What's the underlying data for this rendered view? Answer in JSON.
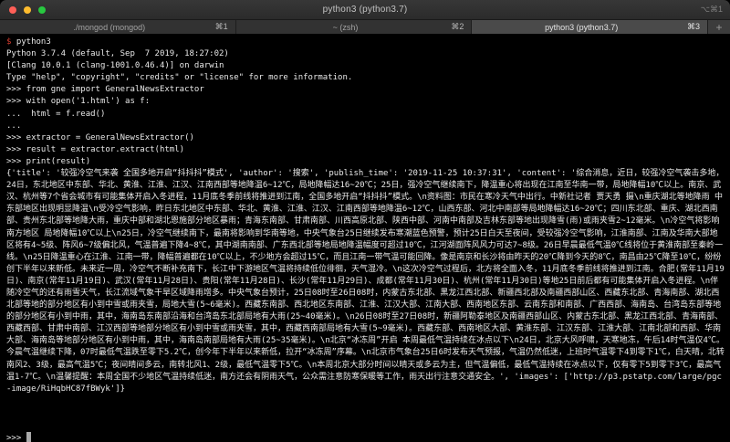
{
  "window": {
    "title": "python3 (python3.7)",
    "titlebar_right_hint": "⌥⌘1",
    "tabs": [
      {
        "label": "./mongod (mongod)",
        "shortcut": "⌘1"
      },
      {
        "label": "~ (zsh)",
        "shortcut": "⌘2"
      },
      {
        "label": "python3 (python3.7)",
        "shortcut": "⌘3"
      }
    ],
    "new_tab_label": "+"
  },
  "colors": {
    "prompt_red": "#d23b2e",
    "terminal_bg": "#000000",
    "terminal_fg": "#e9e9e9",
    "active_tab_bg": "#4a4a4a",
    "traffic_red": "#ff5f57",
    "traffic_yellow": "#febc2e",
    "traffic_green": "#28c840"
  },
  "terminal": {
    "shell_line": {
      "prompt": "$",
      "command": " python3"
    },
    "lines": [
      "Python 3.7.4 (default, Sep  7 2019, 18:27:02)",
      "[Clang 10.0.1 (clang-1001.0.46.4)] on darwin",
      "Type \"help\", \"copyright\", \"credits\" or \"license\" for more information.",
      ">>> from gne import GeneralNewsExtractor",
      ">>> with open('1.html') as f:",
      "...  html = f.read()",
      "...",
      ">>> extractor = GeneralNewsExtractor()",
      ">>> result = extractor.extract(html)",
      ">>> print(result)"
    ],
    "output": "{'title': '较强冷空气来袭 全国多地开启“抖抖抖”模式', 'author': '搜索', 'publish_time': '2019-11-25 10:37:31', 'content': '综合消息，近日，较强冷空气袭击多地，24日，东北地区中东部、华北、黄淮、江淮、江汉、江南西部等地降温6~12℃，局地降幅达16~20℃；25日，强冷空气继续南下，降温重心将出现在江南至华南一带，局地降幅10℃以上。南京、武汉、杭州等7个省会城市有可能集体开启入冬进程，11月底冬季前线将推进到江南，全国多地开启“抖抖抖”模式。\\n资料图：市民在寒冷天气中出行。中新社记者 贾天勇 摄\\n重庆湖北等地降雨 中东部地区出现明显降温\\n受冷空气影响，昨日东北地区中东部、华北、黄淮、江淮、江汉、江南西部等地降温6~12℃，山西东部、河北中南部等局地降幅达16~20℃；四川东北部、重庆、湖北西南部、贵州东北部等地降大雨，重庆中部和湖北恩施部分地区暴雨；青海东南部、甘肃南部、川西高原北部、陕西中部、河南中南部及吉林东部等地出现降雪(雨)或雨夹雪2~12毫米。\\n冷空气将影响南方地区 局地降幅10℃以上\\n25日，冷空气继续南下，最南将影响到华南等地，中央气象台25日继续发布寒潮蓝色预警，预计25日白天至夜间，受较强冷空气影响，江淮南部、江南及华南大部地区将有4~5级、阵风6~7级偏北风，气温普遍下降4~8℃，其中湖南南部、广东西北部等地局地降温幅度可超过10℃，江河湖面阵风风力可达7~8级。26日早晨最低气温0℃线将位于黄淮南部至秦岭一线。\\n25日降温重心在江淮、江南一带，降幅普遍都在10℃以上，不少地方会超过15℃，而且江南一带气温可能回降。像是南京和长沙将由昨天的20℃降到今天的8℃，南昌由25℃降至10℃，纷纷创下半年以来新低。未来近一周，冷空气不断补充南下，长江中下游地区气温将持续低位徘徊，天气湿冷。\\n这次冷空气过程后，北方将全面入冬，11月底冬季前线将推进到江南。合肥(常年11月19日)、南京(常年11月19日)、武汉(常年11月28日)、贵阳(常年11月28日)、长沙(常年11月29日)、成都(常年11月30日)、杭州(常年11月30日)等地25日前后都有可能集体开启入冬进程。\\n伴随冷空气的还有雨雪天气，长江流域气象干旱区域降雨增多。中央气象台预计，25日08时至26日08时，内蒙古东北部、黑龙江西北部、新疆西北部及南疆西部山区、西藏东北部、青海南部、湖北西北部等地的部分地区有小到中雪或雨夹雪，局地大雪(5~6毫米)。西藏东南部、西北地区东南部、江淮、江汉大部、江南大部、西南地区东部、云南东部和南部、广西西部、海南岛、台湾岛东部等地的部分地区有小到中雨，其中，海南岛东南部沿海和台湾岛东北部局地有大雨(25~40毫米)。\\n26日08时至27日08时，新疆阿勒泰地区及南疆西部山区、内蒙古东北部、黑龙江西北部、青海南部、西藏西部、甘肃中南部、江汉西部等地部分地区有小到中雪或雨夹雪，其中，西藏西南部局地有大雪(5~9毫米)。西藏东部、西南地区大部、黄淮东部、江汉东部、江淮大部、江南北部和西部、华南大部、海南岛等地部分地区有小到中雨，其中，海南岛南部局地有大雨(25~35毫米)。\\n北京“冰冻周”开启 本周最低气温持续在冰点以下\\n24日，北京大风呼啸，天寒地冻，午后14时气温仅4℃。今晨气温继续下降，07时最低气温跌至零下5.2℃，创今年下半年以来新低，拉开“冰冻周”序幕。\\n北京市气象台25日6时发布天气预报，气温仍然低迷，上班时气温零下4到零下1℃，白天晴，北转南风2、3级，最高气温5℃；夜间晴间多云，南转北风1、2级，最低气温零下5℃。\\n本周北京大部分时间以晴天或多云为主，但气温偏低，最低气温持续在冰点以下，仅有零下5到零下3℃，最高气温1-7℃。\\n温馨提醒：本周全国不少地区气温持续低迷，南方还会有阴雨天气，公众需注意防寒保暖等工作，雨天出行注意交通安全。', 'images': ['http://p3.pstatp.com/large/pgc-image/RiHqbHC87fBWyk']}",
    "trailing_prompt": ">>> "
  }
}
